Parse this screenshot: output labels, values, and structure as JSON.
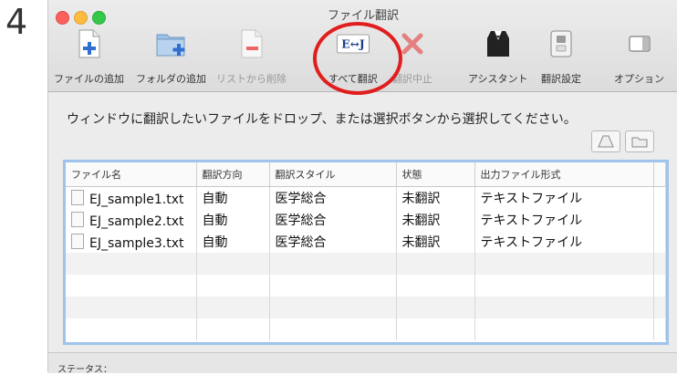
{
  "step_number": "4",
  "window": {
    "title": "ファイル翻訳"
  },
  "toolbar": {
    "items": [
      {
        "label": "ファイルの追加",
        "icon": "add-file-icon"
      },
      {
        "label": "フォルダの追加",
        "icon": "add-folder-icon"
      },
      {
        "label": "リストから削除",
        "icon": "remove-file-icon"
      },
      {
        "label": "すべて翻訳",
        "icon": "ej-translate-icon",
        "icon_text": "E↔J"
      },
      {
        "label": "翻訳中止",
        "icon": "stop-x-icon"
      },
      {
        "label": "アシスタント",
        "icon": "assistant-tuxedo-icon"
      },
      {
        "label": "翻訳設定",
        "icon": "settings-switch-icon"
      },
      {
        "label": "オプション",
        "icon": "options-icon"
      }
    ]
  },
  "instruction": "ウィンドウに翻訳したいファイルをドロップ、または選択ボタンから選択してください。",
  "table": {
    "columns": [
      "ファイル名",
      "翻訳方向",
      "翻訳スタイル",
      "状態",
      "出力ファイル形式"
    ],
    "rows": [
      [
        "EJ_sample1.txt",
        "自動",
        "医学総合",
        "未翻訳",
        "テキストファイル"
      ],
      [
        "EJ_sample2.txt",
        "自動",
        "医学総合",
        "未翻訳",
        "テキストファイル"
      ],
      [
        "EJ_sample3.txt",
        "自動",
        "医学総合",
        "未翻訳",
        "テキストファイル"
      ]
    ]
  },
  "status": {
    "label": "ステータス："
  },
  "colors": {
    "highlight": "#e01e1e",
    "selection_border": "#9fc3ea",
    "accent_blue": "#2f6fd0"
  }
}
